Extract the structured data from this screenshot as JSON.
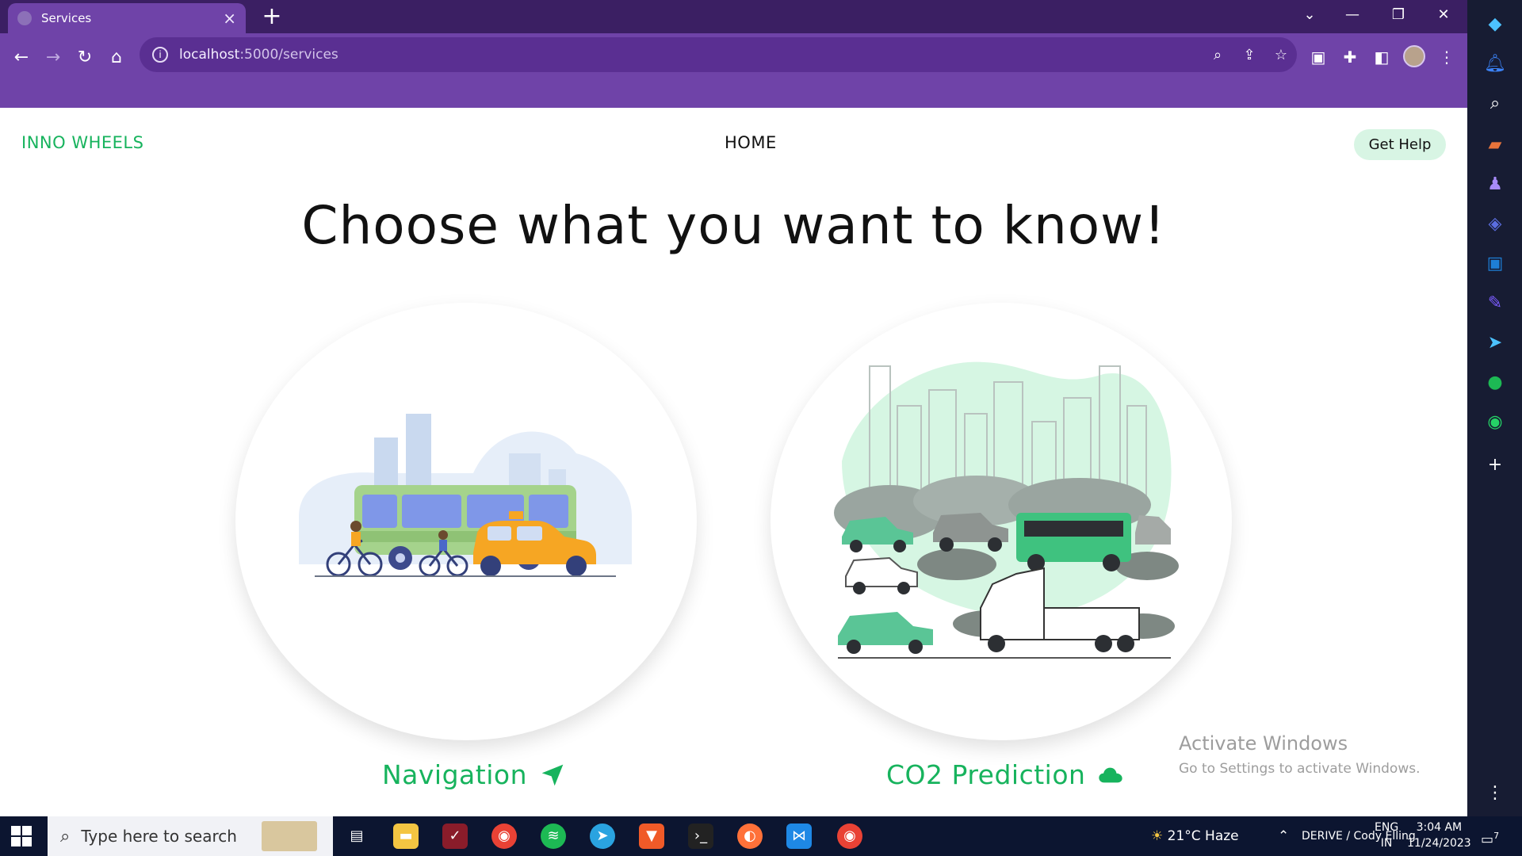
{
  "browser": {
    "tab_title": "Services",
    "url_host": "localhost",
    "url_rest": ":5000/services",
    "colors": {
      "tabbar": "#3b1f63",
      "toolbar": "#6f43a8"
    }
  },
  "navbar": {
    "brand": "INNO WHEELS",
    "home_link": "HOME",
    "help_button": "Get Help"
  },
  "main": {
    "heading": "Choose what you want to know!",
    "cards": [
      {
        "label": "Navigation",
        "icon": "send-arrow-icon",
        "illustration": "city-traffic-bus-bicycles-taxi"
      },
      {
        "label": "CO2 Prediction",
        "icon": "cloud-icon",
        "illustration": "polluting-traffic-city"
      }
    ],
    "accent": "#17b35d"
  },
  "watermark": {
    "title": "Activate Windows",
    "subtitle": "Go to Settings to activate Windows."
  },
  "taskbar": {
    "search_placeholder": "Type here to search",
    "weather": "21°C Haze",
    "lang_top": "ENG",
    "lang_bottom": "IN",
    "time": "3:04 AM",
    "date": "11/24/2023",
    "tray_text": "DERIVE / Cody Elling",
    "notification_count": "7"
  }
}
